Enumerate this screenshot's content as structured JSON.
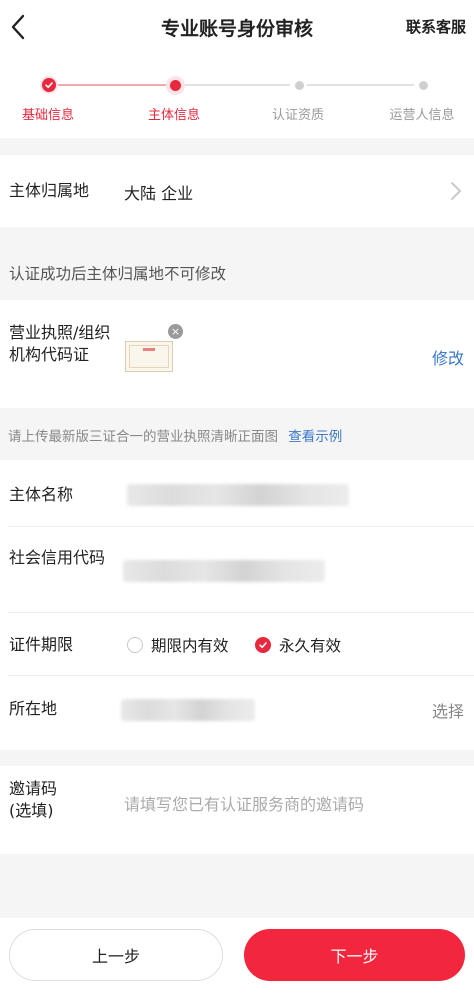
{
  "header": {
    "title": "专业账号身份审核",
    "contact": "联系客服"
  },
  "steps": [
    {
      "label": "基础信息",
      "state": "done"
    },
    {
      "label": "主体信息",
      "state": "active"
    },
    {
      "label": "认证资质",
      "state": "todo"
    },
    {
      "label": "运营人信息",
      "state": "todo"
    }
  ],
  "entity_location": {
    "label": "主体归属地",
    "value": "大陆 企业"
  },
  "location_note": "认证成功后主体归属地不可修改",
  "license": {
    "label": "营业执照/组织机构代码证",
    "edit": "修改",
    "hint": "请上传最新版三证合一的营业执照清晰正面图",
    "example_link": "查看示例"
  },
  "entity_name": {
    "label": "主体名称"
  },
  "credit_code": {
    "label": "社会信用代码"
  },
  "validity": {
    "label": "证件期限",
    "options": [
      "期限内有效",
      "永久有效"
    ],
    "selected": "永久有效"
  },
  "address": {
    "label": "所在地",
    "action": "选择"
  },
  "invite": {
    "label": "邀请码(选填)",
    "placeholder": "请填写您已有认证服务商的邀请码"
  },
  "buttons": {
    "prev": "上一步",
    "next": "下一步"
  },
  "colors": {
    "accent": "#e8283e",
    "link": "#3a78c8"
  }
}
